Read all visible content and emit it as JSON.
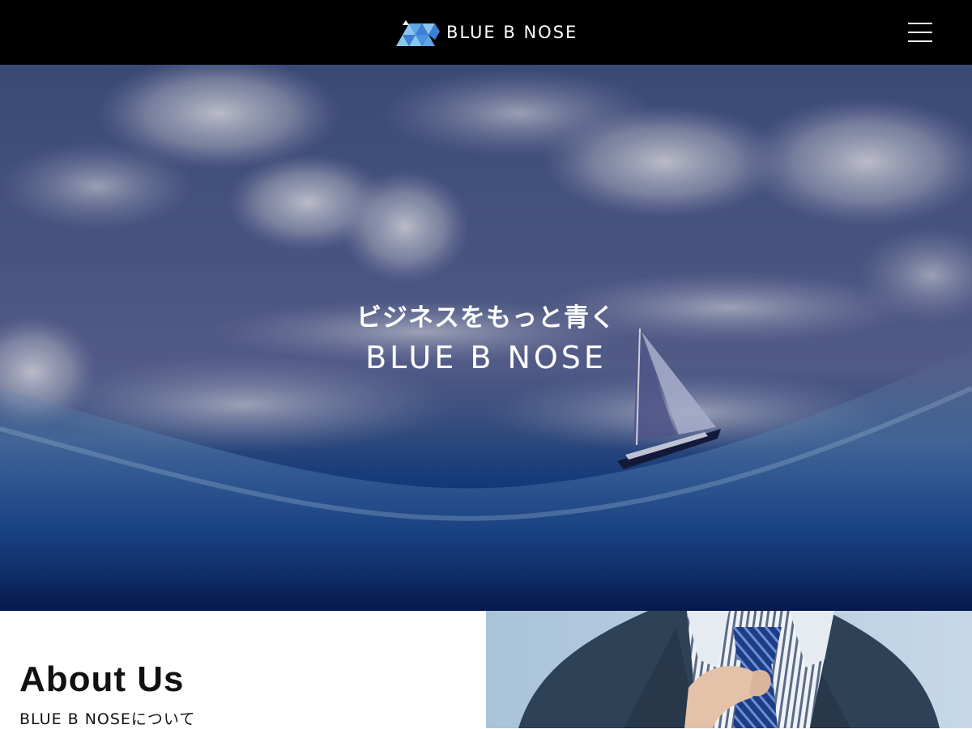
{
  "header": {
    "logo_text": "BLUE B NOSE",
    "logo_icon": "triangle-mosaic-logo",
    "menu_icon": "hamburger-menu-icon",
    "background_color": "#000000"
  },
  "hero": {
    "tagline": "ビジネスをもっと青く",
    "title": "BLUE B NOSE",
    "image_description_icon": "sky-sailboat-image"
  },
  "about": {
    "heading": "About Us",
    "subheading": "BLUE B NOSEについて",
    "image_icon": "businessman-tie-image"
  },
  "colors": {
    "brand_blue": "#3b7fd6",
    "brand_light_blue": "#8cc6f0",
    "text_white": "#ffffff",
    "text_dark": "#111111"
  }
}
